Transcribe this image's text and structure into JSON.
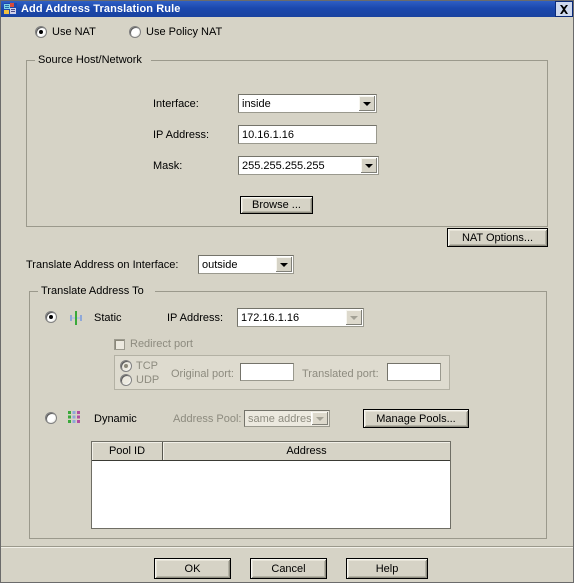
{
  "window": {
    "title": "Add Address Translation Rule",
    "icon": "app-icon",
    "close_icon": "close-icon"
  },
  "mode": {
    "nat_label": "Use NAT",
    "nat_selected": true,
    "policy_nat_label": "Use Policy NAT",
    "policy_nat_selected": false
  },
  "source_group": {
    "title": "Source Host/Network",
    "interface_label": "Interface:",
    "interface_value": "inside",
    "ip_label": "IP Address:",
    "ip_value": "10.16.1.16",
    "mask_label": "Mask:",
    "mask_value": "255.255.255.255",
    "browse_label": "Browse ..."
  },
  "nat_options_label": "NAT Options...",
  "translate_iface": {
    "label": "Translate Address on Interface:",
    "value": "outside"
  },
  "translate_group": {
    "title": "Translate Address To",
    "static": {
      "label": "Static",
      "selected": true,
      "icon": "static-nat-icon",
      "ip_label": "IP Address:",
      "ip_value": "172.16.1.16"
    },
    "redirect": {
      "checkbox_label": "Redirect port",
      "checked": false,
      "tcp_label": "TCP",
      "tcp_selected": true,
      "udp_label": "UDP",
      "udp_selected": false,
      "original_port_label": "Original port:",
      "original_port_value": "",
      "translated_port_label": "Translated port:",
      "translated_port_value": ""
    },
    "dynamic": {
      "label": "Dynamic",
      "selected": false,
      "icon": "dynamic-nat-icon",
      "address_pool_label": "Address Pool:",
      "address_pool_value": "same address",
      "manage_pools_label": "Manage Pools..."
    },
    "pool_table": {
      "columns": [
        "Pool ID",
        "Address"
      ],
      "rows": []
    }
  },
  "footer": {
    "ok_label": "OK",
    "cancel_label": "Cancel",
    "help_label": "Help"
  },
  "colors": {
    "titlebar": "#1b48ae",
    "face": "#d6d3c6",
    "field": "#ffffff",
    "disabled_text": "#8d8b7f"
  }
}
